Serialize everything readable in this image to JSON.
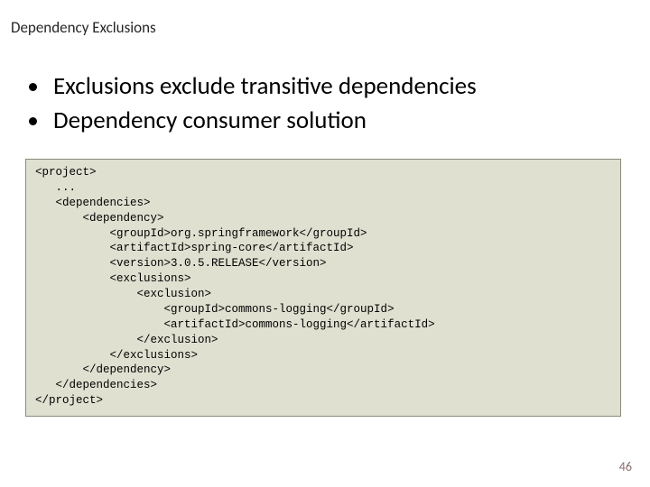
{
  "title": "Dependency Exclusions",
  "bullets": [
    "Exclusions exclude transitive dependencies",
    "Dependency consumer solution"
  ],
  "code": "<project>\n   ...\n   <dependencies>\n       <dependency>\n           <groupId>org.springframework</groupId>\n           <artifactId>spring-core</artifactId>\n           <version>3.0.5.RELEASE</version>\n           <exclusions>\n               <exclusion>\n                   <groupId>commons-logging</groupId>\n                   <artifactId>commons-logging</artifactId>\n               </exclusion>\n           </exclusions>\n       </dependency>\n   </dependencies>\n</project>",
  "page_number": "46"
}
